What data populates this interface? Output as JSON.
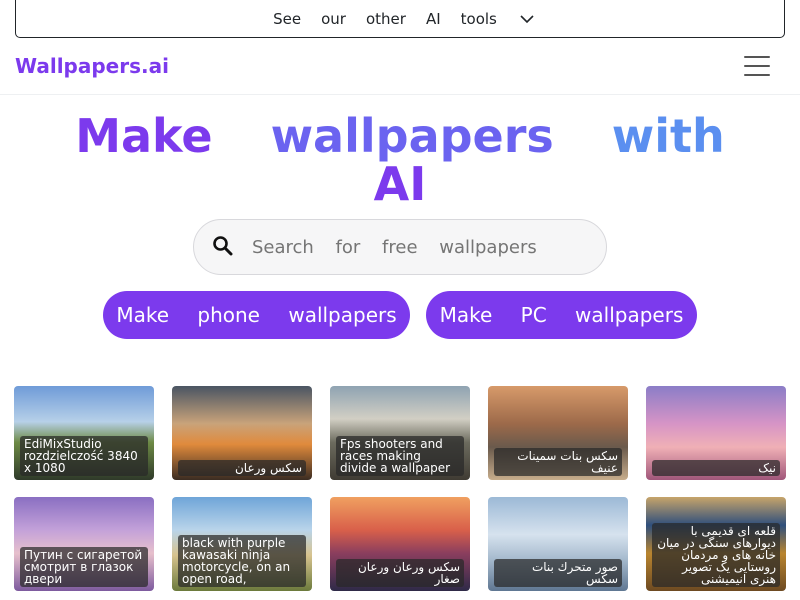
{
  "promo": {
    "words": [
      "See",
      "our",
      "other",
      "AI",
      "tools"
    ]
  },
  "navbar": {
    "brand": "Wallpapers.ai"
  },
  "hero": {
    "line1": [
      "Make",
      "wallpapers",
      "with"
    ],
    "line2": "AI"
  },
  "search": {
    "placeholder": "Search for free wallpapers"
  },
  "buttons": {
    "phone": "Make phone wallpapers",
    "pc": "Make PC wallpapers"
  },
  "cards": [
    {
      "caption": "EdiMixStudio rozdzielczość 3840 x 1080",
      "rtl": false
    },
    {
      "caption": "سکس ورعان",
      "rtl": true
    },
    {
      "caption": "Fps shooters and races making divide a wallpaper",
      "rtl": false
    },
    {
      "caption": "سکس بنات سمینات عنیف",
      "rtl": true
    },
    {
      "caption": "نیک",
      "rtl": true
    },
    {
      "caption": "Путин с сигаретой смотрит в глазок двери",
      "rtl": false
    },
    {
      "caption": "black with purple kawasaki ninja motorcycle, on an open road,",
      "rtl": false
    },
    {
      "caption": "سکس ورعان ورعان صغار",
      "rtl": true
    },
    {
      "caption": "صور متحرك بنات سكس",
      "rtl": true
    },
    {
      "caption": "قلعه ای قدیمی با دیوارهای سنگی در میان خانه های و مردمان روستایی یک تصویر هنری انیمیشنی",
      "rtl": true
    }
  ]
}
